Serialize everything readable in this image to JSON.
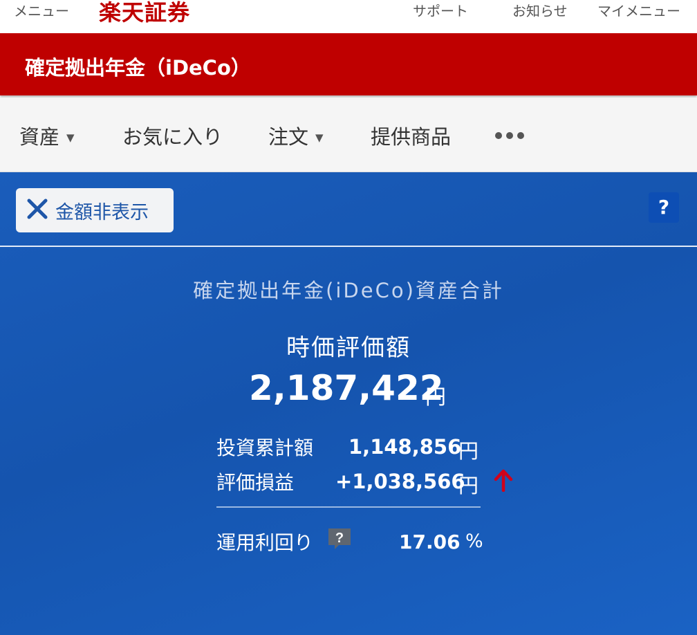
{
  "header": {
    "menu_label": "メニュー",
    "logo_text": "楽天証券",
    "support_label": "サポート",
    "notice_label": "お知らせ",
    "mymenu_label": "マイメニュー"
  },
  "titlebar": {
    "title": "確定拠出年金（iDeCo）"
  },
  "nav": {
    "items": [
      {
        "label": "資産",
        "has_dropdown": true
      },
      {
        "label": "お気に入り",
        "has_dropdown": false
      },
      {
        "label": "注文",
        "has_dropdown": true
      },
      {
        "label": "提供商品",
        "has_dropdown": false
      }
    ],
    "caret": "▼",
    "more_icon": "more-dots-icon"
  },
  "panel": {
    "hide_amount_label": "金額非表示",
    "help_label": "?",
    "summary_title": "確定拠出年金(iDeCo)資産合計",
    "market_value_label": "時価評価額",
    "market_value": "2,187,422",
    "currency": "円",
    "rows": [
      {
        "label": "投資累計額",
        "value": "1,148,856",
        "unit": "円"
      },
      {
        "label": "評価損益",
        "value": "+1,038,566",
        "unit": "円",
        "trend": "up"
      }
    ],
    "yield_label": "運用利回り",
    "yield_help": "?",
    "yield_value": "17.06",
    "yield_unit": "%"
  },
  "colors": {
    "brand_red": "#bf0000",
    "panel_blue": "#1554ae",
    "up_arrow": "#d0021b"
  }
}
